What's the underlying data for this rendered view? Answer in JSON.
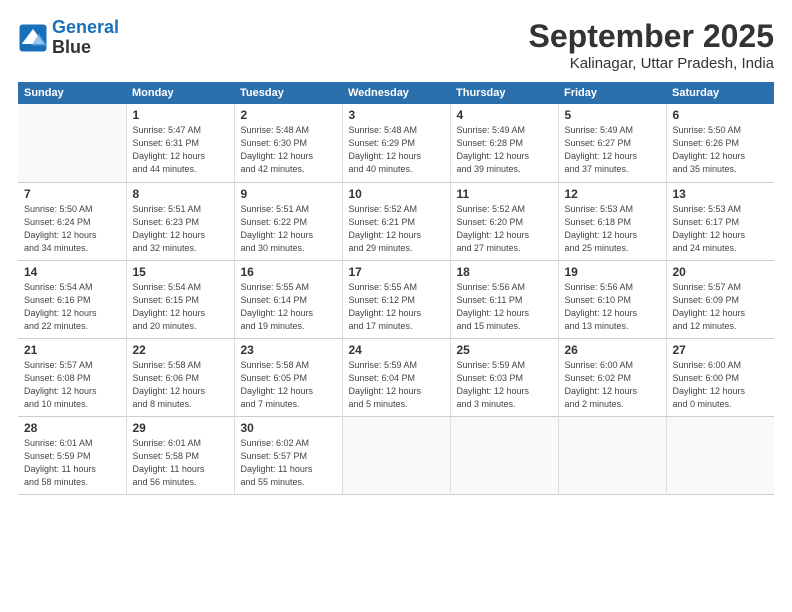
{
  "header": {
    "logo_line1": "General",
    "logo_line2": "Blue",
    "month": "September 2025",
    "location": "Kalinagar, Uttar Pradesh, India"
  },
  "weekdays": [
    "Sunday",
    "Monday",
    "Tuesday",
    "Wednesday",
    "Thursday",
    "Friday",
    "Saturday"
  ],
  "weeks": [
    [
      {
        "day": "",
        "info": ""
      },
      {
        "day": "1",
        "info": "Sunrise: 5:47 AM\nSunset: 6:31 PM\nDaylight: 12 hours\nand 44 minutes."
      },
      {
        "day": "2",
        "info": "Sunrise: 5:48 AM\nSunset: 6:30 PM\nDaylight: 12 hours\nand 42 minutes."
      },
      {
        "day": "3",
        "info": "Sunrise: 5:48 AM\nSunset: 6:29 PM\nDaylight: 12 hours\nand 40 minutes."
      },
      {
        "day": "4",
        "info": "Sunrise: 5:49 AM\nSunset: 6:28 PM\nDaylight: 12 hours\nand 39 minutes."
      },
      {
        "day": "5",
        "info": "Sunrise: 5:49 AM\nSunset: 6:27 PM\nDaylight: 12 hours\nand 37 minutes."
      },
      {
        "day": "6",
        "info": "Sunrise: 5:50 AM\nSunset: 6:26 PM\nDaylight: 12 hours\nand 35 minutes."
      }
    ],
    [
      {
        "day": "7",
        "info": "Sunrise: 5:50 AM\nSunset: 6:24 PM\nDaylight: 12 hours\nand 34 minutes."
      },
      {
        "day": "8",
        "info": "Sunrise: 5:51 AM\nSunset: 6:23 PM\nDaylight: 12 hours\nand 32 minutes."
      },
      {
        "day": "9",
        "info": "Sunrise: 5:51 AM\nSunset: 6:22 PM\nDaylight: 12 hours\nand 30 minutes."
      },
      {
        "day": "10",
        "info": "Sunrise: 5:52 AM\nSunset: 6:21 PM\nDaylight: 12 hours\nand 29 minutes."
      },
      {
        "day": "11",
        "info": "Sunrise: 5:52 AM\nSunset: 6:20 PM\nDaylight: 12 hours\nand 27 minutes."
      },
      {
        "day": "12",
        "info": "Sunrise: 5:53 AM\nSunset: 6:18 PM\nDaylight: 12 hours\nand 25 minutes."
      },
      {
        "day": "13",
        "info": "Sunrise: 5:53 AM\nSunset: 6:17 PM\nDaylight: 12 hours\nand 24 minutes."
      }
    ],
    [
      {
        "day": "14",
        "info": "Sunrise: 5:54 AM\nSunset: 6:16 PM\nDaylight: 12 hours\nand 22 minutes."
      },
      {
        "day": "15",
        "info": "Sunrise: 5:54 AM\nSunset: 6:15 PM\nDaylight: 12 hours\nand 20 minutes."
      },
      {
        "day": "16",
        "info": "Sunrise: 5:55 AM\nSunset: 6:14 PM\nDaylight: 12 hours\nand 19 minutes."
      },
      {
        "day": "17",
        "info": "Sunrise: 5:55 AM\nSunset: 6:12 PM\nDaylight: 12 hours\nand 17 minutes."
      },
      {
        "day": "18",
        "info": "Sunrise: 5:56 AM\nSunset: 6:11 PM\nDaylight: 12 hours\nand 15 minutes."
      },
      {
        "day": "19",
        "info": "Sunrise: 5:56 AM\nSunset: 6:10 PM\nDaylight: 12 hours\nand 13 minutes."
      },
      {
        "day": "20",
        "info": "Sunrise: 5:57 AM\nSunset: 6:09 PM\nDaylight: 12 hours\nand 12 minutes."
      }
    ],
    [
      {
        "day": "21",
        "info": "Sunrise: 5:57 AM\nSunset: 6:08 PM\nDaylight: 12 hours\nand 10 minutes."
      },
      {
        "day": "22",
        "info": "Sunrise: 5:58 AM\nSunset: 6:06 PM\nDaylight: 12 hours\nand 8 minutes."
      },
      {
        "day": "23",
        "info": "Sunrise: 5:58 AM\nSunset: 6:05 PM\nDaylight: 12 hours\nand 7 minutes."
      },
      {
        "day": "24",
        "info": "Sunrise: 5:59 AM\nSunset: 6:04 PM\nDaylight: 12 hours\nand 5 minutes."
      },
      {
        "day": "25",
        "info": "Sunrise: 5:59 AM\nSunset: 6:03 PM\nDaylight: 12 hours\nand 3 minutes."
      },
      {
        "day": "26",
        "info": "Sunrise: 6:00 AM\nSunset: 6:02 PM\nDaylight: 12 hours\nand 2 minutes."
      },
      {
        "day": "27",
        "info": "Sunrise: 6:00 AM\nSunset: 6:00 PM\nDaylight: 12 hours\nand 0 minutes."
      }
    ],
    [
      {
        "day": "28",
        "info": "Sunrise: 6:01 AM\nSunset: 5:59 PM\nDaylight: 11 hours\nand 58 minutes."
      },
      {
        "day": "29",
        "info": "Sunrise: 6:01 AM\nSunset: 5:58 PM\nDaylight: 11 hours\nand 56 minutes."
      },
      {
        "day": "30",
        "info": "Sunrise: 6:02 AM\nSunset: 5:57 PM\nDaylight: 11 hours\nand 55 minutes."
      },
      {
        "day": "",
        "info": ""
      },
      {
        "day": "",
        "info": ""
      },
      {
        "day": "",
        "info": ""
      },
      {
        "day": "",
        "info": ""
      }
    ]
  ]
}
